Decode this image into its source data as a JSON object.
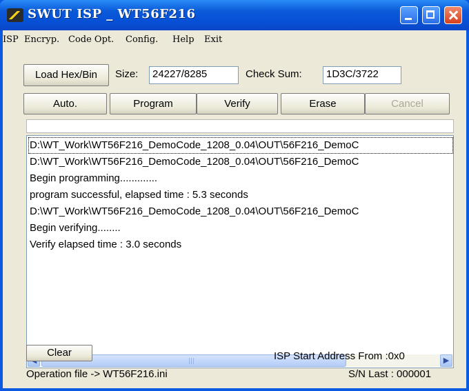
{
  "window": {
    "title": "SWUT ISP _ WT56F216",
    "controls": {
      "minimize": "minimize-icon",
      "maximize": "maximize-icon",
      "close": "close-icon"
    }
  },
  "menu": [
    "ISP",
    "Encryp.",
    "Code Opt.",
    "Config.",
    "Help",
    "Exit"
  ],
  "toolbar": {
    "load_label": "Load Hex/Bin",
    "size_label": "Size:",
    "size_value": "24227/8285",
    "checksum_label": "Check Sum:",
    "checksum_value": "1D3C/3722"
  },
  "actions": {
    "auto": "Auto.",
    "program": "Program",
    "verify": "Verify",
    "erase": "Erase",
    "cancel": "Cancel"
  },
  "progress": {
    "value": 0
  },
  "log": [
    "D:\\WT_Work\\WT56F216_DemoCode_1208_0.04\\OUT\\56F216_DemoC",
    "D:\\WT_Work\\WT56F216_DemoCode_1208_0.04\\OUT\\56F216_DemoC",
    "Begin programming.............",
    "program successful, elapsed time : 5.3 seconds",
    "D:\\WT_Work\\WT56F216_DemoCode_1208_0.04\\OUT\\56F216_DemoC",
    "Begin verifying........",
    "Verify elapsed time : 3.0 seconds"
  ],
  "footer": {
    "clear_label": "Clear",
    "isp_start": "ISP Start Address From :0x0",
    "operation_file": "Operation file -> WT56F216.ini",
    "sn_last": "S/N Last : 000001"
  }
}
